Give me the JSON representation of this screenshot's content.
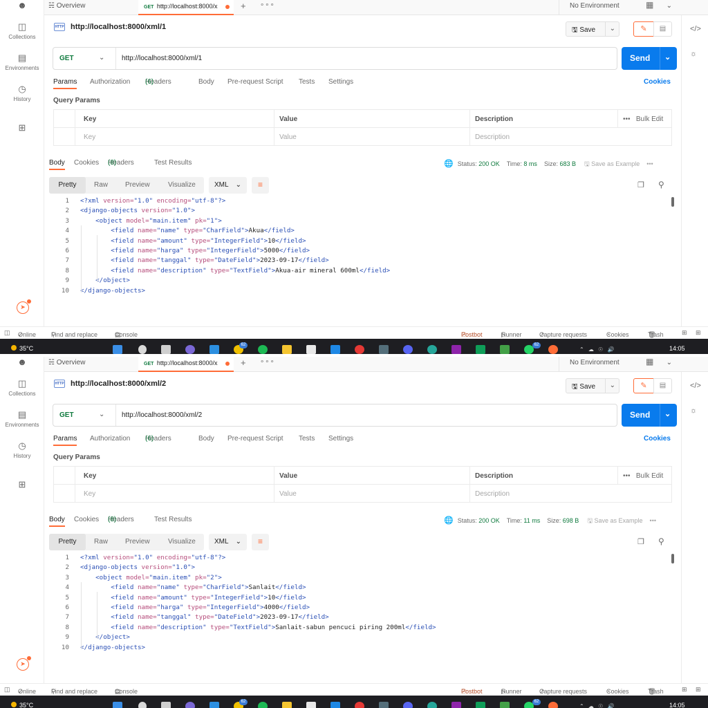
{
  "rail": {
    "items": [
      {
        "label": "Collections"
      },
      {
        "label": "Environments"
      },
      {
        "label": "History"
      }
    ]
  },
  "colors": {
    "accent": "#ff6c37",
    "send": "#097bed",
    "method_get": "#0f7a3e",
    "status_ok": "#0f7a3e"
  },
  "tabs": {
    "overview": "Overview",
    "active_method": "GET",
    "add": "+",
    "more": "∘∘∘"
  },
  "environment": "No Environment",
  "request_tabs": [
    {
      "label": "Params"
    },
    {
      "label": "Authorization"
    },
    {
      "label": "Headers",
      "count": "(6)"
    },
    {
      "label": "Body"
    },
    {
      "label": "Pre-request Script"
    },
    {
      "label": "Tests"
    },
    {
      "label": "Settings"
    }
  ],
  "cookies_link": "Cookies",
  "save_label": "Save",
  "send_label": "Send",
  "query_params": {
    "title": "Query Params",
    "headers": [
      "Key",
      "Value",
      "Description"
    ],
    "bulk_edit": "Bulk Edit",
    "placeholders": [
      "Key",
      "Value",
      "Description"
    ]
  },
  "response_tabs": [
    {
      "label": "Body"
    },
    {
      "label": "Cookies"
    },
    {
      "label": "Headers",
      "count": "(8)"
    },
    {
      "label": "Test Results"
    }
  ],
  "format_tabs": [
    "Pretty",
    "Raw",
    "Preview",
    "Visualize"
  ],
  "format_select": "XML",
  "save_example": "Save as Example",
  "footer": {
    "online": "Online",
    "find": "Find and replace",
    "console": "Console",
    "postbot": "Postbot",
    "runner": "Runner",
    "capture": "Capture requests",
    "cookies": "Cookies",
    "trash": "Trash"
  },
  "taskbar": {
    "temp": "35°C",
    "time": "14:05",
    "badge": "62"
  },
  "panes": [
    {
      "tab_title": "http://localhost:8000/x",
      "request_title": "http://localhost:8000/xml/1",
      "method": "GET",
      "url": "http://localhost:8000/xml/1",
      "status": "200 OK",
      "time": "8 ms",
      "size": "683 B",
      "xml": {
        "pk": "1",
        "name": "Akua",
        "amount": "10",
        "harga": "5000",
        "tanggal": "2023-09-17",
        "description": "Akua-air mineral 600ml"
      }
    },
    {
      "tab_title": "http://localhost:8000/x",
      "request_title": "http://localhost:8000/xml/2",
      "method": "GET",
      "url": "http://localhost:8000/xml/2",
      "status": "200 OK",
      "time": "11 ms",
      "size": "698 B",
      "xml": {
        "pk": "2",
        "name": "Sanlait",
        "amount": "10",
        "harga": "4000",
        "tanggal": "2023-09-17",
        "description": "Sanlait-sabun pencuci piring 200ml"
      }
    }
  ]
}
